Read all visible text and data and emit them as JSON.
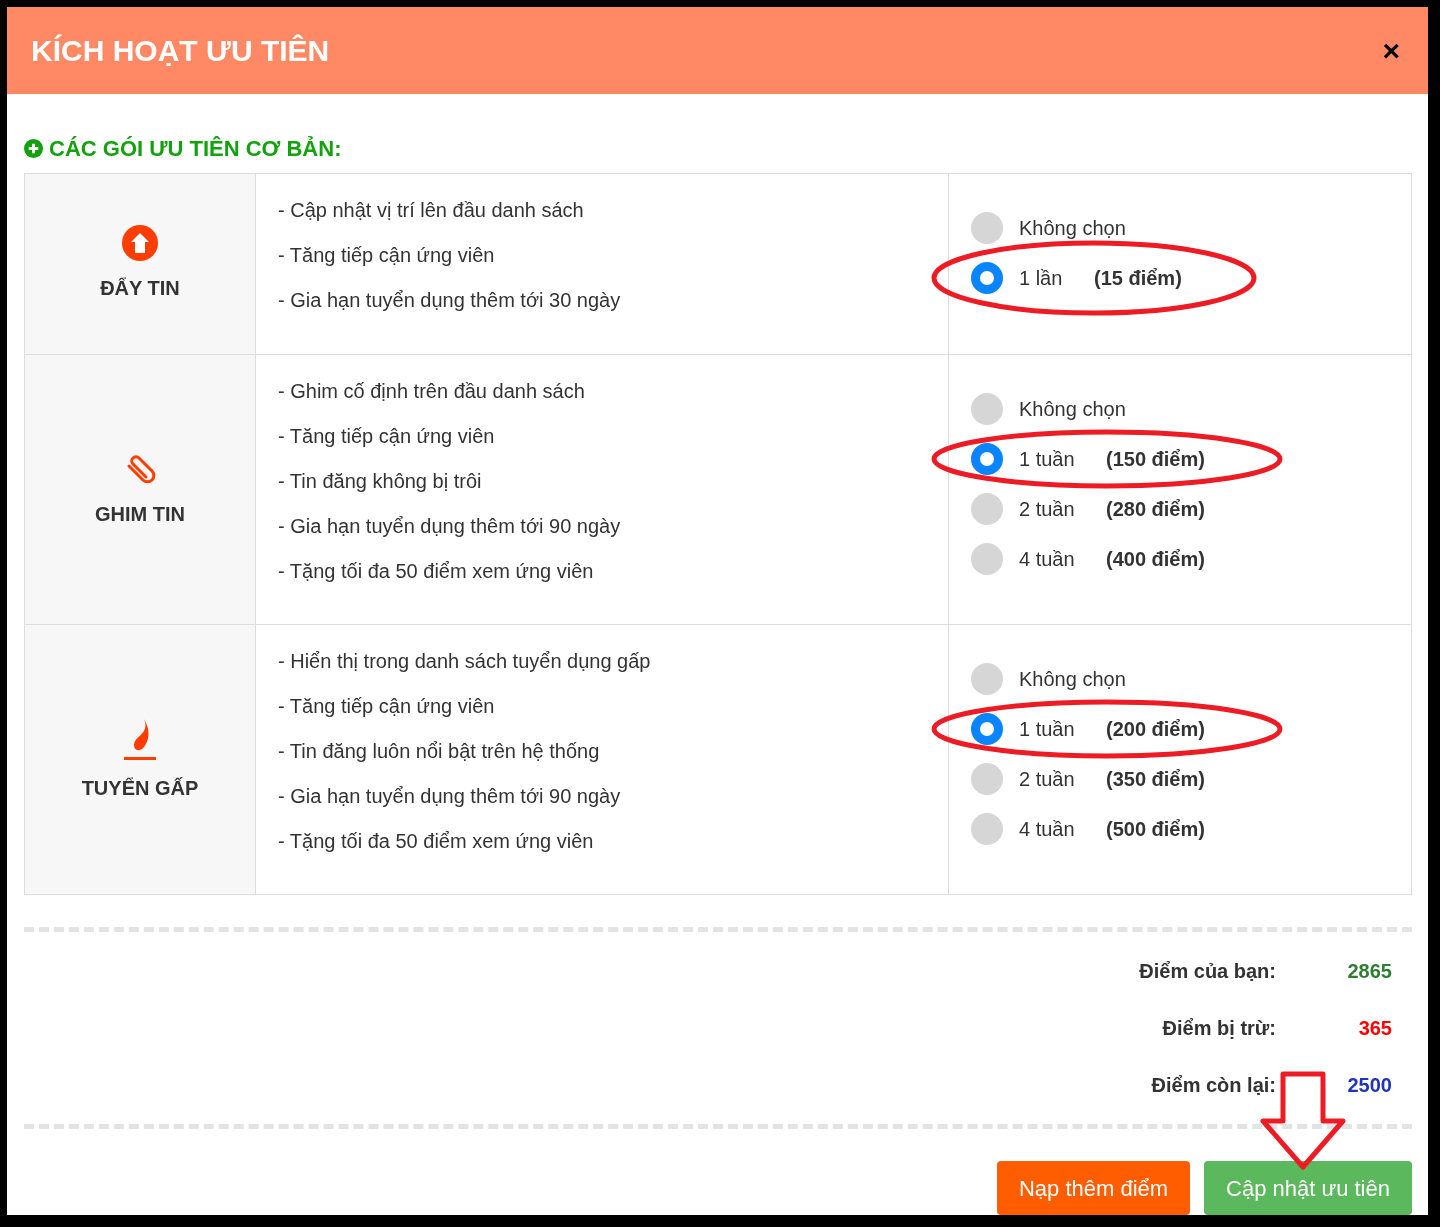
{
  "modal": {
    "title": "KÍCH HOẠT ƯU TIÊN",
    "close_label": "×"
  },
  "section_title": "CÁC GÓI ƯU TIÊN CƠ BẢN:",
  "packages": [
    {
      "kind": "push",
      "name": "ĐẨY TIN",
      "benefits": [
        "- Cập nhật vị trí lên đầu danh sách",
        "- Tăng tiếp cận ứng viên",
        "- Gia hạn tuyển dụng thêm tới 30 ngày"
      ],
      "options": [
        {
          "label": "Không chọn",
          "selected": false
        },
        {
          "label": "1 lần",
          "points": "(15 điểm)",
          "selected": true
        }
      ]
    },
    {
      "kind": "pin",
      "name": "GHIM TIN",
      "benefits": [
        "- Ghim cố định trên đầu danh sách",
        "- Tăng tiếp cận ứng viên",
        "- Tin đăng không bị trôi",
        "- Gia hạn tuyển dụng thêm tới 90 ngày",
        "- Tặng tối đa 50 điểm xem ứng viên"
      ],
      "options": [
        {
          "label": "Không chọn",
          "selected": false
        },
        {
          "label": "1 tuần",
          "points": "(150 điểm)",
          "selected": true
        },
        {
          "label": "2 tuần",
          "points": "(280 điểm)",
          "selected": false
        },
        {
          "label": "4 tuần",
          "points": "(400 điểm)",
          "selected": false
        }
      ]
    },
    {
      "kind": "urgent",
      "name": "TUYỂN GẤP",
      "benefits": [
        "- Hiển thị trong danh sách tuyển dụng gấp",
        "- Tăng tiếp cận ứng viên",
        "- Tin đăng luôn nổi bật trên hệ thống",
        "- Gia hạn tuyển dụng thêm tới 90 ngày",
        "- Tặng tối đa 50 điểm xem ứng viên"
      ],
      "options": [
        {
          "label": "Không chọn",
          "selected": false
        },
        {
          "label": "1 tuần",
          "points": "(200 điểm)",
          "selected": true
        },
        {
          "label": "2 tuần",
          "points": "(350 điểm)",
          "selected": false
        },
        {
          "label": "4 tuần",
          "points": "(500 điểm)",
          "selected": false
        }
      ]
    }
  ],
  "totals": [
    {
      "label": "Điểm của bạn:",
      "value": "2865",
      "color": "#2e7d32"
    },
    {
      "label": "Điểm bị trừ:",
      "value": "365",
      "color": "#ff0000"
    },
    {
      "label": "Điểm còn lại:",
      "value": "2500",
      "color": "#2233bb"
    }
  ],
  "buttons": [
    {
      "kind": "topup",
      "label": "Nạp thêm điểm"
    },
    {
      "kind": "update",
      "label": "Cập nhật ưu tiên"
    }
  ],
  "pointer_arrow": true
}
